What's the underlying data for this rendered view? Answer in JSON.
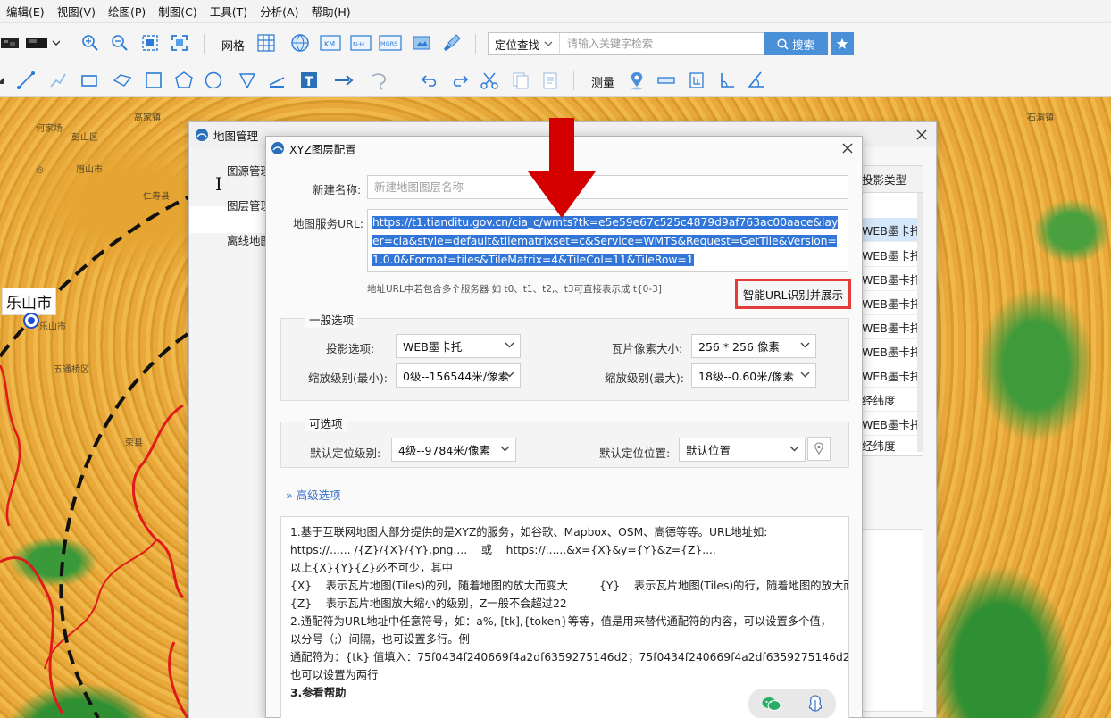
{
  "menu": [
    "编辑(E)",
    "视图(V)",
    "绘图(P)",
    "制图(C)",
    "工具(T)",
    "分析(A)",
    "帮助(H)"
  ],
  "toolbar": {
    "grid_label": "网格",
    "search_type": "定位查找",
    "search_placeholder": "请输入关键字检索",
    "search_button": "搜索",
    "measure_label": "测量"
  },
  "map": {
    "city_label": "乐山市",
    "places": [
      "乐山市",
      "眉山市",
      "彭山区",
      "高家镇",
      "五通桥区",
      "仁寿县",
      "荣县",
      "石洞镇"
    ]
  },
  "manager": {
    "title": "地图管理",
    "nav": [
      "图源管理",
      "图层管理",
      "离线地图"
    ],
    "column_header": "投影类型",
    "rows": [
      "WEB墨卡托",
      "WEB墨卡托",
      "WEB墨卡托",
      "WEB墨卡托",
      "WEB墨卡托",
      "WEB墨卡托",
      "WEB墨卡托",
      "经纬度",
      "WEB墨卡托",
      "经纬度"
    ]
  },
  "xyz": {
    "title": "XYZ图层配置",
    "name_label": "新建名称:",
    "name_placeholder": "新建地图图层名称",
    "url_label": "地图服务URL:",
    "url_value": "https://t1.tianditu.gov.cn/cia_c/wmts?tk=e5e59e67c525c4879d9af763ac00aace&layer=cia&style=default&tilematrixset=c&Service=WMTS&Request=GetTile&Version=1.0.0&Format=tiles&TileMatrix=4&TileCol=11&TileRow=1",
    "url_hint": "地址URL中若包含多个服务器 如 t0、t1、t2,、t3可直接表示成 t{0-3]",
    "smart_button": "智能URL识别并展示",
    "general": {
      "title": "一般选项",
      "projection_label": "投影选项:",
      "projection_value": "WEB墨卡托",
      "tile_size_label": "瓦片像素大小:",
      "tile_size_value": "256 * 256 像素",
      "zoom_min_label": "缩放级别(最小):",
      "zoom_min_value": "0级--156544米/像素",
      "zoom_max_label": "缩放级别(最大):",
      "zoom_max_value": "18级--0.60米/像素"
    },
    "optional": {
      "title": "可选项",
      "level_label": "默认定位级别:",
      "level_value": "4级--9784米/像素",
      "pos_label": "默认定位位置:",
      "pos_value": "默认位置"
    },
    "advanced": "高级选项",
    "help_lines": [
      "1.基于互联网地图大部分提供的是XYZ的服务，如谷歌、Mapbox、OSM、高德等等。URL地址如:",
      "https://...... /{Z}/{X}/{Y}.png....    或    https://......&x={X}&y={Y}&z={Z}....",
      "以上{X}{Y}{Z}必不可少，其中",
      "{X}    表示瓦片地图(Tiles)的列，随着地图的放大而变大         {Y}    表示瓦片地图(Tiles)的行，随着地图的放大而变大",
      "{Z}    表示瓦片地图放大缩小的级别，Z一般不会超过22",
      "2.通配符为URL地址中任意符号，如：a%, [tk],{token}等等，值是用来替代通配符的内容，可以设置多个值，",
      "以分号（;）间隔，也可设置多行。例",
      "通配符为：{tk} 值填入：75f0434f240669f4a2df6359275146d2；75f0434f240669f4a2df6359275146d2",
      "也可以设置为两行"
    ],
    "help_bold": "3.参看帮助"
  },
  "colors": {
    "accent": "#4a90d9",
    "highlight": "#3176d8",
    "alert": "#e13b3b",
    "arrow": "#d40000"
  }
}
